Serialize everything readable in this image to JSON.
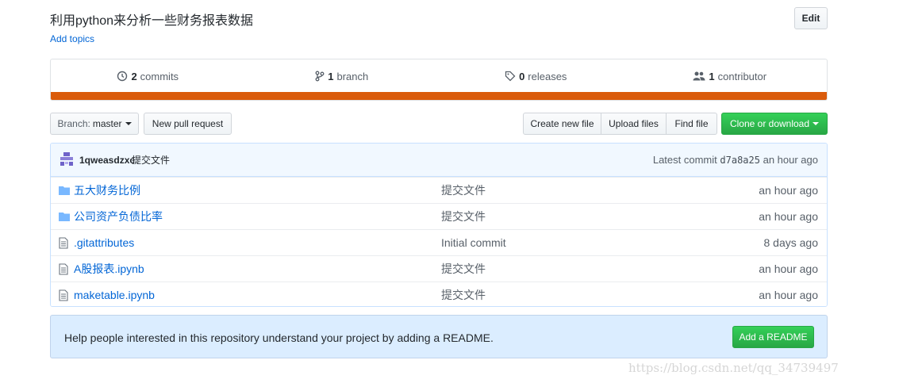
{
  "repo": {
    "description": "利用python来分析一些财务报表数据",
    "add_topics": "Add topics",
    "edit_label": "Edit"
  },
  "summary": {
    "commits": {
      "count": "2",
      "label": "commits"
    },
    "branches": {
      "count": "1",
      "label": "branch"
    },
    "releases": {
      "count": "0",
      "label": "releases"
    },
    "contributors": {
      "count": "1",
      "label": "contributor"
    },
    "lang_bar_color": "#da5b0b"
  },
  "toolbar": {
    "branch_prefix": "Branch:",
    "branch_name": "master",
    "new_pull_request": "New pull request",
    "create_new_file": "Create new file",
    "upload_files": "Upload files",
    "find_file": "Find file",
    "clone_or_download": "Clone or download"
  },
  "latest_commit": {
    "author": "1qweasdzxc",
    "message": "提交文件",
    "latest_label": "Latest commit",
    "sha": "d7a8a25",
    "age": "an hour ago"
  },
  "files": [
    {
      "type": "folder",
      "name": "五大财务比例",
      "message": "提交文件",
      "age": "an hour ago"
    },
    {
      "type": "folder",
      "name": "公司资产负债比率",
      "message": "提交文件",
      "age": "an hour ago"
    },
    {
      "type": "file",
      "name": ".gitattributes",
      "message": "Initial commit",
      "age": "8 days ago"
    },
    {
      "type": "file",
      "name": "A股报表.ipynb",
      "message": "提交文件",
      "age": "an hour ago"
    },
    {
      "type": "file",
      "name": "maketable.ipynb",
      "message": "提交文件",
      "age": "an hour ago"
    }
  ],
  "readme_prompt": {
    "text": "Help people interested in this repository understand your project by adding a README.",
    "button": "Add a README"
  },
  "watermark": "https://blog.csdn.net/qq_34739497",
  "colors": {
    "link": "#0366d6",
    "green_button": "#28a745",
    "readme_bg": "#dbedff"
  }
}
